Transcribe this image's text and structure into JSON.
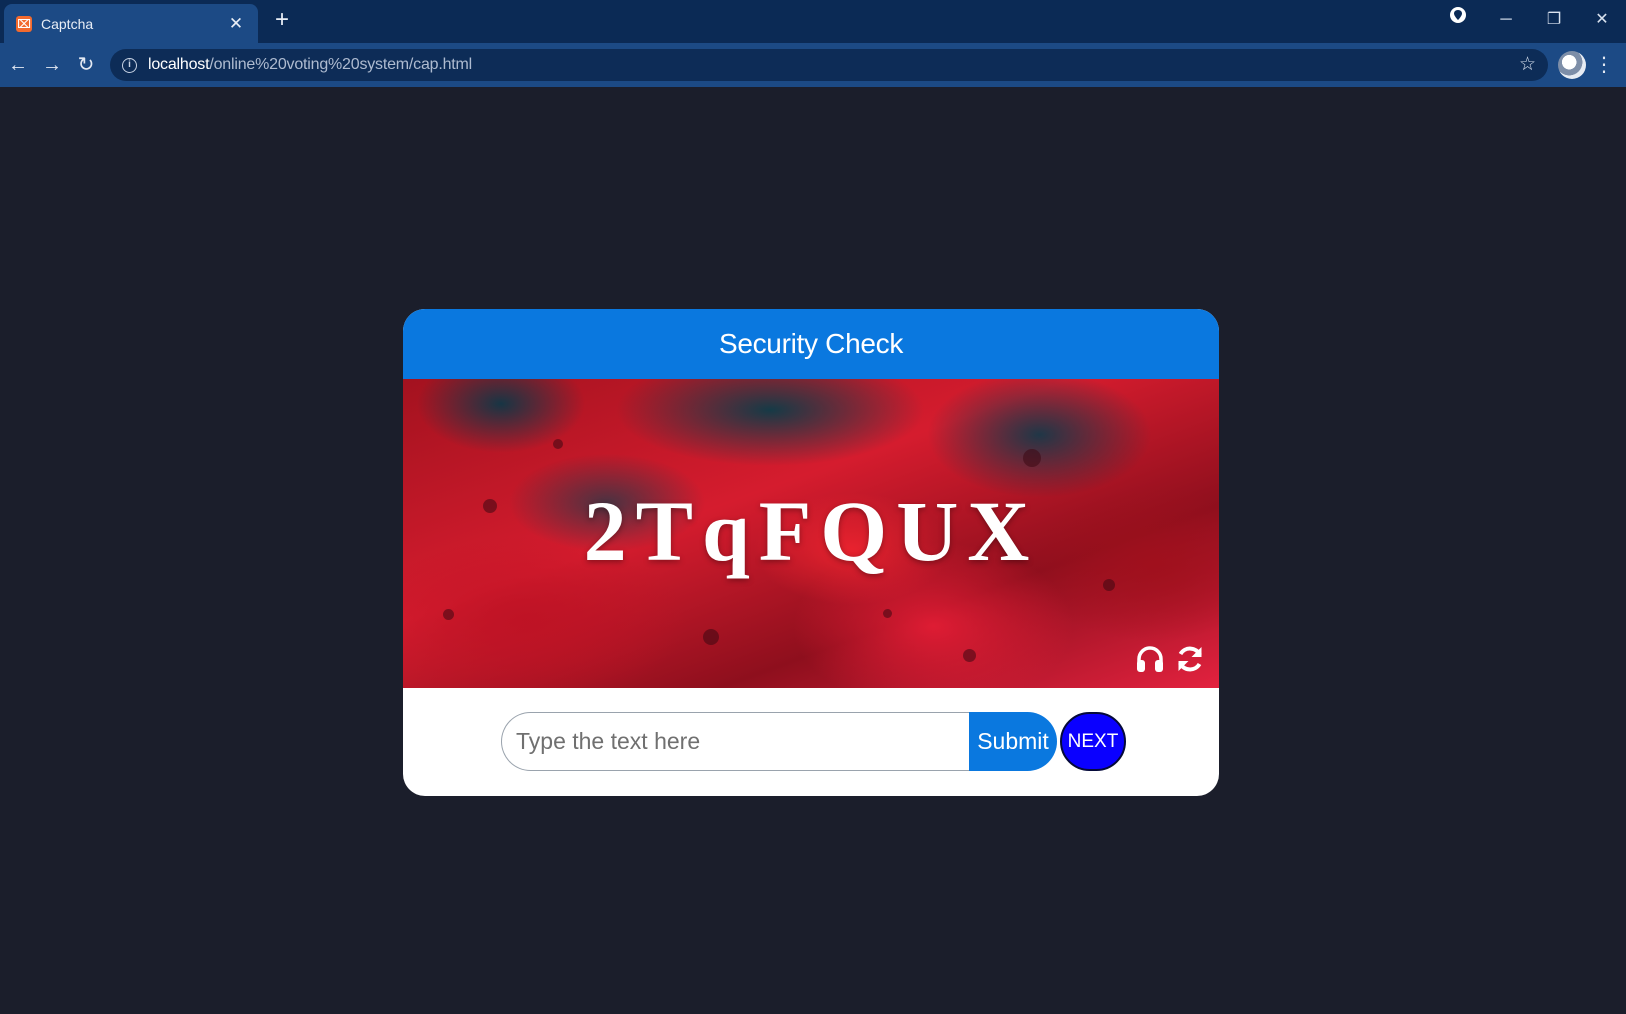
{
  "browser": {
    "tab_title": "Captcha",
    "tab_close": "✕",
    "new_tab": "+",
    "url_host": "localhost",
    "url_path": "/online%20voting%20system/cap.html",
    "window_controls": {
      "minimize": "─",
      "restore": "❐",
      "close": "✕"
    },
    "nav": {
      "back": "←",
      "forward": "→",
      "reload": "↻"
    },
    "menu": "⋮",
    "bookmark": "☆"
  },
  "card": {
    "title": "Security Check",
    "captcha_text": "2TqFQUX",
    "input_placeholder": "Type the text here",
    "submit_label": "Submit",
    "next_label": "NEXT"
  },
  "colors": {
    "page_background": "#1b1e2b",
    "header_blue": "#0a78df",
    "next_blue": "#0a00ff"
  },
  "icons": {
    "audio": "headphones-icon",
    "refresh": "refresh-icon"
  }
}
